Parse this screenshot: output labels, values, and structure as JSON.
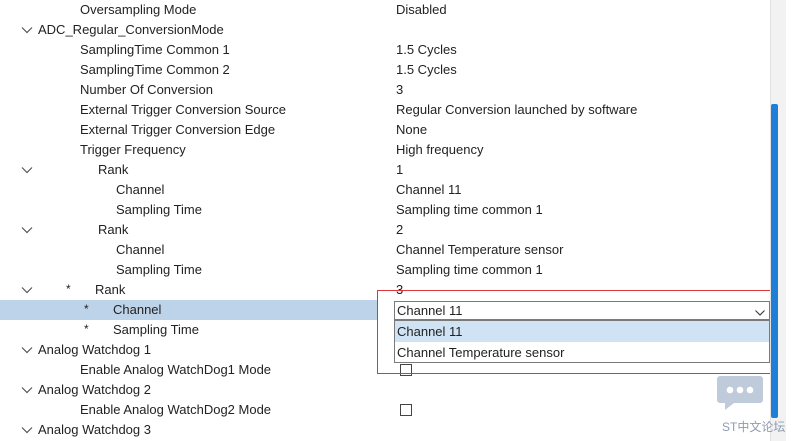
{
  "rows": [
    {
      "label": "Oversampling Mode",
      "value": "Disabled"
    },
    {
      "label": "ADC_Regular_ConversionMode"
    },
    {
      "label": "SamplingTime Common 1",
      "value": "1.5 Cycles"
    },
    {
      "label": "SamplingTime Common 2",
      "value": "1.5 Cycles"
    },
    {
      "label": "Number Of Conversion",
      "value": "3"
    },
    {
      "label": "External Trigger Conversion Source",
      "value": "Regular Conversion launched by software"
    },
    {
      "label": "External Trigger Conversion Edge",
      "value": "None"
    },
    {
      "label": "Trigger Frequency",
      "value": "High frequency"
    },
    {
      "label": "Rank",
      "value": "1"
    },
    {
      "label": "Channel",
      "value": "Channel 11"
    },
    {
      "label": "Sampling Time",
      "value": "Sampling time common 1"
    },
    {
      "label": "Rank",
      "value": "2"
    },
    {
      "label": "Channel",
      "value": "Channel Temperature sensor"
    },
    {
      "label": "Sampling Time",
      "value": "Sampling time common 1"
    },
    {
      "label": "Rank",
      "value": "3",
      "marker": "*"
    },
    {
      "label": "Channel",
      "value": "Channel 11",
      "marker": "*"
    },
    {
      "label": "Sampling Time",
      "marker": "*"
    },
    {
      "label": "Analog Watchdog 1"
    },
    {
      "label": "Enable Analog WatchDog1 Mode",
      "checked": false
    },
    {
      "label": "Analog Watchdog 2"
    },
    {
      "label": "Enable Analog WatchDog2 Mode",
      "checked": false
    },
    {
      "label": "Analog Watchdog 3"
    }
  ],
  "dropdown": {
    "options": [
      "Channel 11",
      "Channel Temperature sensor"
    ],
    "highlighted": "Channel 11"
  },
  "watermark": {
    "text": "ST中文论坛"
  },
  "colors": {
    "selection": "#bcd3ea",
    "highlight": "#cfe3f4",
    "accent": "#1f7fd6",
    "callout": "#d9363e"
  }
}
